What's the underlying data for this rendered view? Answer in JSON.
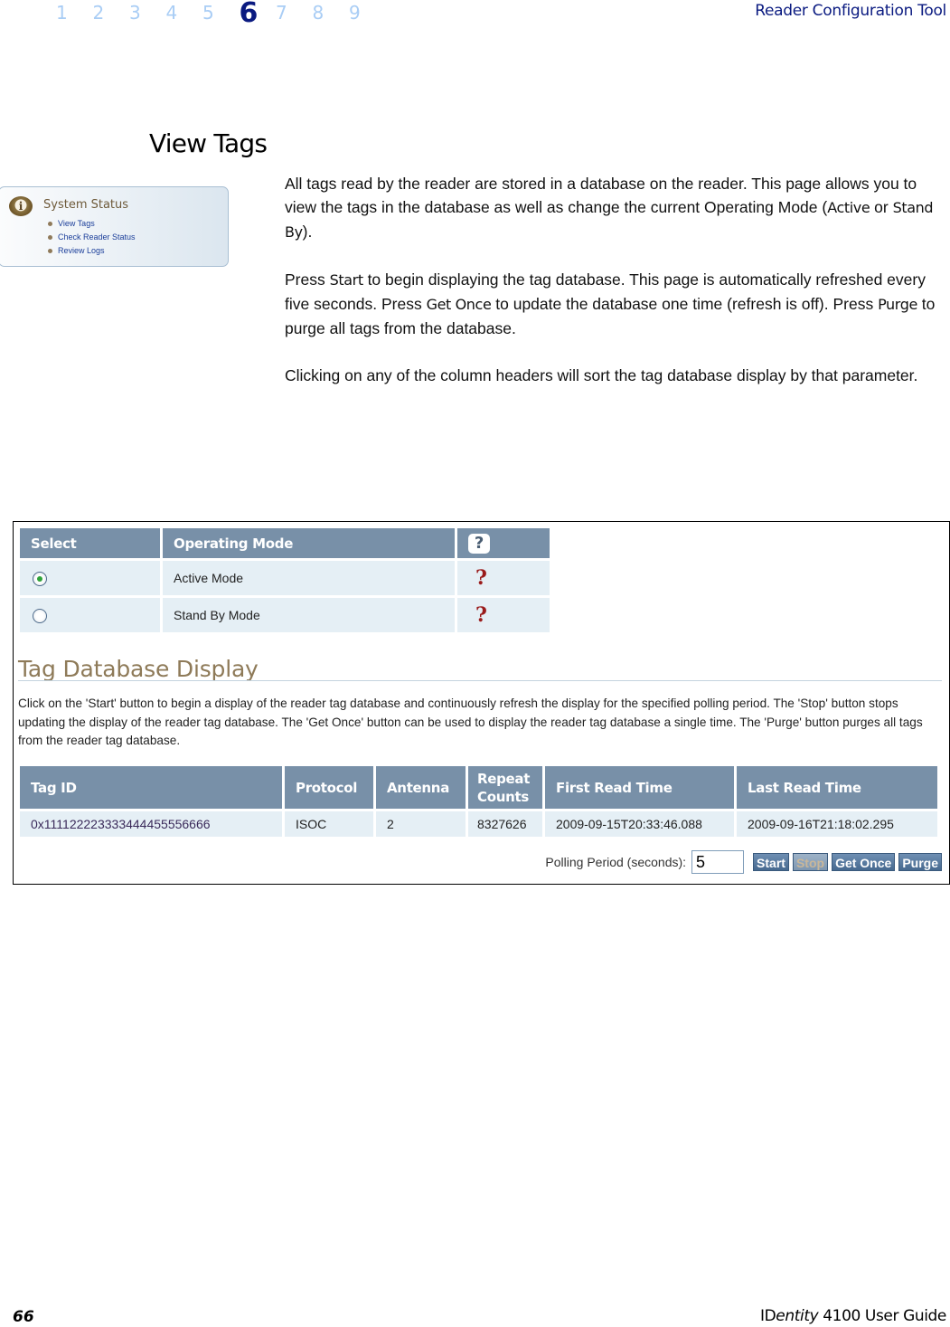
{
  "header": {
    "chapters": [
      "1",
      "2",
      "3",
      "4",
      "5",
      "6",
      "7",
      "8",
      "9"
    ],
    "active_chapter": "6",
    "running_title": "Reader Configuration Tool"
  },
  "section": {
    "title": "View Tags"
  },
  "sidebar_thumbnail": {
    "title": "System Status",
    "icon": "info-icon",
    "items": [
      "View Tags",
      "Check Reader Status",
      "Review Logs"
    ]
  },
  "body": {
    "p1": {
      "text1": "All tags read by the reader are stored in a database on the reader. This page allows you to view the tags in the database as well as change the current Operating Mode (",
      "kw1": "Active",
      "text2": " or ",
      "kw2": "Stand By",
      "text3": ")."
    },
    "p2": {
      "text1": "Press ",
      "kw1": "Start",
      "text2": " to begin displaying the tag database. This page is automatically refreshed every five seconds. Press ",
      "kw2": "Get Once",
      "text3": " to update the database one time (refresh is off). Press ",
      "kw3": "Purge",
      "text4": " to purge all tags from the database."
    },
    "p3": "Clicking on any of the column headers will sort the tag database display by that parameter."
  },
  "screenshot": {
    "mode_table": {
      "headers": [
        "Select",
        "Operating Mode",
        "?"
      ],
      "rows": [
        {
          "mode": "Active Mode",
          "selected": true,
          "help": "?"
        },
        {
          "mode": "Stand By Mode",
          "selected": false,
          "help": "?"
        }
      ]
    },
    "tag_db": {
      "title": "Tag Database Display",
      "description": "Click on the 'Start' button to begin a display of the reader tag database and continuously refresh the display for the specified polling period. The 'Stop' button stops updating the display of the reader tag database. The 'Get Once' button can be used to display the reader tag database a single time. The 'Purge' button purges all tags from the reader tag database.",
      "headers": [
        "Tag ID",
        "Protocol",
        "Antenna",
        "Repeat Counts",
        "First Read Time",
        "Last Read Time"
      ],
      "rows": [
        {
          "tag_id": "0x111122223333444455556666",
          "protocol": "ISOC",
          "antenna": "2",
          "repeat_counts": "8327626",
          "first_read": "2009-09-15T20:33:46.088",
          "last_read": "2009-09-16T21:18:02.295"
        }
      ],
      "polling_label": "Polling Period (seconds):",
      "polling_value": "5",
      "buttons": {
        "start": "Start",
        "stop": "Stop",
        "get_once": "Get Once",
        "purge": "Purge"
      }
    }
  },
  "footer": {
    "page_number": "66",
    "guide_brand_prefix": "ID",
    "guide_brand_italic": "entity",
    "guide_rest": " 4100 User Guide"
  }
}
